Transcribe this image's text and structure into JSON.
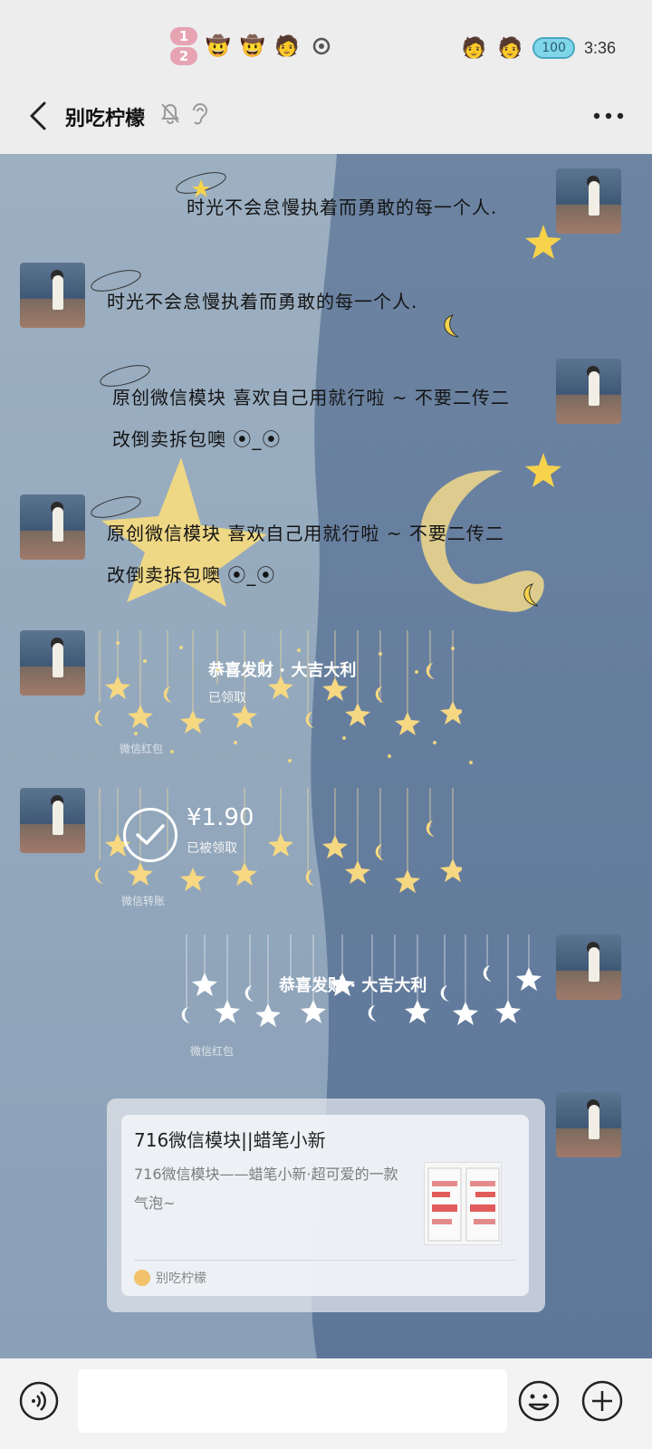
{
  "status_bar": {
    "time": "3:36",
    "battery": "100",
    "notif_badges": [
      "1",
      "2"
    ]
  },
  "header": {
    "title": "别吃柠檬"
  },
  "messages": [
    {
      "side": "right",
      "text": "时光不会怠慢执着而勇敢的每一个人."
    },
    {
      "side": "left",
      "text": "时光不会怠慢执着而勇敢的每一个人."
    },
    {
      "side": "right",
      "line1": "原创微信模块 喜欢自己用就行啦 ~ 不要二传二",
      "line2": "改倒卖拆包噢 ⦿_⦿"
    },
    {
      "side": "left",
      "line1": "原创微信模块 喜欢自己用就行啦 ~ 不要二传二",
      "line2": "改倒卖拆包噢 ⦿_⦿"
    }
  ],
  "red_packet_left": {
    "title": "恭喜发财 · 大吉大利",
    "status": "已领取",
    "footer": "微信红包"
  },
  "transfer_left": {
    "amount": "¥1.90",
    "status": "已被领取",
    "footer": "微信转账"
  },
  "red_packet_right": {
    "title": "恭喜发财 · 大吉大利",
    "footer": "微信红包"
  },
  "link_card": {
    "title": "716微信模块||蜡笔小新",
    "description": "716微信模块——蜡笔小新·超可爱的一款气泡~",
    "source": "别吃柠檬"
  },
  "input_bar": {
    "placeholder": ""
  },
  "colors": {
    "star": "#f7dc7e",
    "chat_left_bg": "#93a5b8",
    "chat_right_bg": "#6d84a1"
  }
}
